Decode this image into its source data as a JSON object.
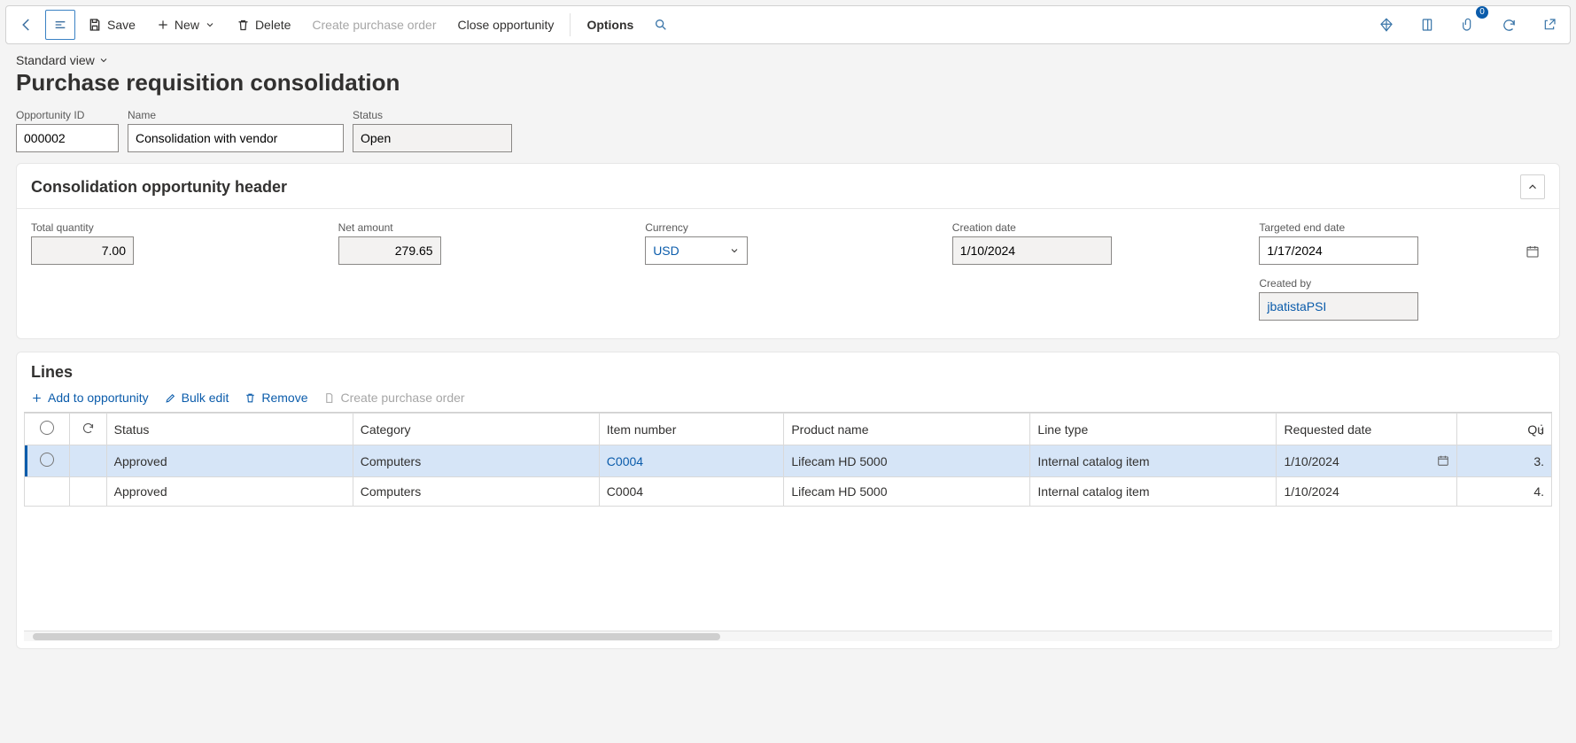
{
  "toolbar": {
    "save": "Save",
    "new": "New",
    "delete": "Delete",
    "create_po": "Create purchase order",
    "close_opp": "Close opportunity",
    "options": "Options",
    "badge_count": "0"
  },
  "view": {
    "label": "Standard view"
  },
  "page_title": "Purchase requisition consolidation",
  "identity": {
    "opp_id_label": "Opportunity ID",
    "opp_id": "000002",
    "name_label": "Name",
    "name": "Consolidation with vendor",
    "status_label": "Status",
    "status": "Open"
  },
  "header_card": {
    "title": "Consolidation opportunity header",
    "total_qty_label": "Total quantity",
    "total_qty": "7.00",
    "net_amount_label": "Net amount",
    "net_amount": "279.65",
    "currency_label": "Currency",
    "currency": "USD",
    "creation_date_label": "Creation date",
    "creation_date": "1/10/2024",
    "target_date_label": "Targeted end date",
    "target_date": "1/17/2024",
    "created_by_label": "Created by",
    "created_by": "jbatistaPSI"
  },
  "lines_card": {
    "title": "Lines",
    "add": "Add to opportunity",
    "bulk": "Bulk edit",
    "remove": "Remove",
    "create_po": "Create purchase order",
    "columns": {
      "status": "Status",
      "category": "Category",
      "item": "Item number",
      "product": "Product name",
      "ltype": "Line type",
      "reqdate": "Requested date",
      "qty": "Qu"
    },
    "rows": [
      {
        "status": "Approved",
        "category": "Computers",
        "item": "C0004",
        "product": "Lifecam HD 5000",
        "ltype": "Internal catalog item",
        "reqdate": "1/10/2024",
        "qty": "3."
      },
      {
        "status": "Approved",
        "category": "Computers",
        "item": "C0004",
        "product": "Lifecam HD 5000",
        "ltype": "Internal catalog item",
        "reqdate": "1/10/2024",
        "qty": "4."
      }
    ]
  }
}
